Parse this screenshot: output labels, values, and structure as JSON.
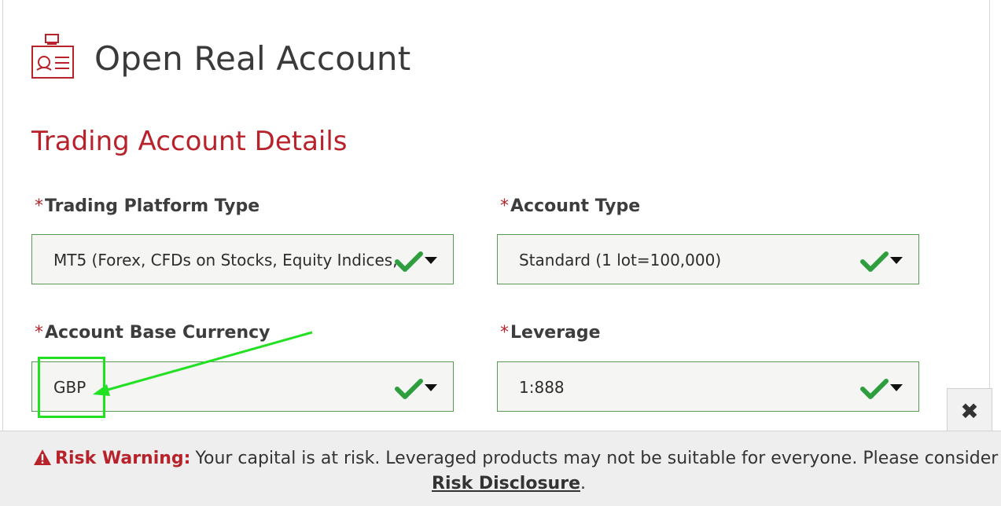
{
  "header": {
    "title": "Open Real Account",
    "icon": "id-card-icon"
  },
  "section": {
    "title": "Trading Account Details"
  },
  "fields": [
    {
      "label": "Trading Platform Type",
      "required_mark": "*",
      "value": "MT5 (Forex, CFDs on Stocks, Equity Indices,"
    },
    {
      "label": "Account Type",
      "required_mark": "*",
      "value": "Standard (1 lot=100,000)"
    },
    {
      "label": "Account Base Currency",
      "required_mark": "*",
      "value": "GBP"
    },
    {
      "label": "Leverage",
      "required_mark": "*",
      "value": "1:888"
    }
  ],
  "risk": {
    "label": "Risk Warning:",
    "text": "Your capital is at risk. Leveraged products may not be suitable for everyone. Please consider our",
    "link": "Risk Disclosure",
    "suffix": "."
  },
  "close_icon": "close-icon",
  "colors": {
    "accent": "#b8232b",
    "valid_border": "#5a9a55",
    "check": "#2e9e3e",
    "annotation": "#22e022"
  }
}
